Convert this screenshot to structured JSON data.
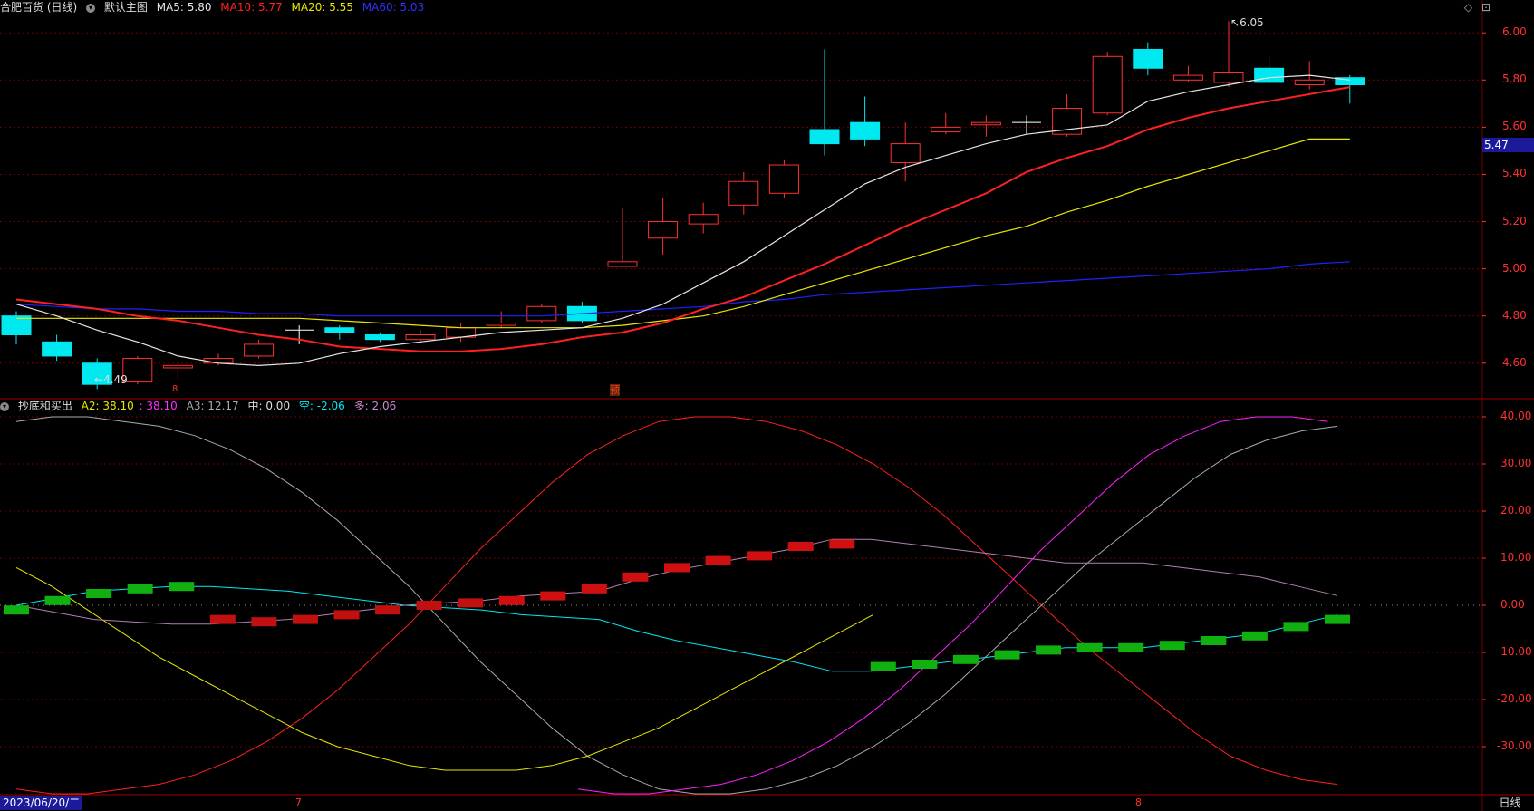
{
  "header": {
    "stock_title": "合肥百货 (日线)",
    "main_chart_label": "默认主图",
    "ma5_label": "MA5: 5.80",
    "ma10_label": "MA10: 5.77",
    "ma20_label": "MA20: 5.55",
    "ma60_label": "MA60: 5.03"
  },
  "indicator_header": {
    "name": "抄底和买出",
    "a2": "A2: 38.10",
    "a2b": ": 38.10",
    "a3": "A3: 12.17",
    "mid": "中: 0.00",
    "kong": "空: -2.06",
    "duo": "多: 2.06"
  },
  "colors": {
    "up": "#ff3030",
    "down": "#00e8f0",
    "ma5": "#e6e6e6",
    "ma10": "#ff2020",
    "ma20": "#e8e800",
    "ma60": "#2020ff",
    "grid": "#700000",
    "axis_text": "#ff3030"
  },
  "price_axis": {
    "ticks": [
      "6.00",
      "5.80",
      "5.60",
      "5.40",
      "5.20",
      "5.00",
      "4.80",
      "4.60"
    ],
    "current": "5.47"
  },
  "indicator_axis": {
    "ticks": [
      "40.00",
      "30.00",
      "20.00",
      "10.00",
      "0.00",
      "-10.00",
      "-20.00",
      "-30.00"
    ]
  },
  "annotations": {
    "high": "6.05",
    "low": "4.49",
    "marker_red": "8",
    "marker_yu": "预"
  },
  "bottom_axis": {
    "date": "2023/06/20/二",
    "month7": "7",
    "month8": "8",
    "period": "日线"
  },
  "top_icons": {
    "diamond": "◇",
    "window": "⊡"
  },
  "chart_data": {
    "type": "candlestick",
    "price_ylim": [
      4.48,
      6.07
    ],
    "candles": [
      {
        "o": 4.8,
        "c": 4.72,
        "h": 4.82,
        "l": 4.68
      },
      {
        "o": 4.69,
        "c": 4.63,
        "h": 4.72,
        "l": 4.61
      },
      {
        "o": 4.6,
        "c": 4.51,
        "h": 4.62,
        "l": 4.49
      },
      {
        "o": 4.52,
        "c": 4.62,
        "h": 4.63,
        "l": 4.51
      },
      {
        "o": 4.58,
        "c": 4.59,
        "h": 4.61,
        "l": 4.52
      },
      {
        "o": 4.6,
        "c": 4.62,
        "h": 4.64,
        "l": 4.59
      },
      {
        "o": 4.63,
        "c": 4.68,
        "h": 4.7,
        "l": 4.62
      },
      {
        "o": 4.74,
        "c": 4.74,
        "h": 4.76,
        "l": 4.68
      },
      {
        "o": 4.75,
        "c": 4.73,
        "h": 4.76,
        "l": 4.7
      },
      {
        "o": 4.72,
        "c": 4.7,
        "h": 4.73,
        "l": 4.69
      },
      {
        "o": 4.7,
        "c": 4.72,
        "h": 4.74,
        "l": 4.69
      },
      {
        "o": 4.71,
        "c": 4.75,
        "h": 4.77,
        "l": 4.69
      },
      {
        "o": 4.76,
        "c": 4.77,
        "h": 4.82,
        "l": 4.75
      },
      {
        "o": 4.78,
        "c": 4.84,
        "h": 4.85,
        "l": 4.77
      },
      {
        "o": 4.84,
        "c": 4.78,
        "h": 4.86,
        "l": 4.77
      },
      {
        "o": 5.01,
        "c": 5.03,
        "h": 5.26,
        "l": 5.01
      },
      {
        "o": 5.13,
        "c": 5.2,
        "h": 5.3,
        "l": 5.06
      },
      {
        "o": 5.19,
        "c": 5.23,
        "h": 5.28,
        "l": 5.15
      },
      {
        "o": 5.27,
        "c": 5.37,
        "h": 5.41,
        "l": 5.23
      },
      {
        "o": 5.32,
        "c": 5.44,
        "h": 5.46,
        "l": 5.3
      },
      {
        "o": 5.59,
        "c": 5.53,
        "h": 5.93,
        "l": 5.48
      },
      {
        "o": 5.62,
        "c": 5.55,
        "h": 5.73,
        "l": 5.52
      },
      {
        "o": 5.45,
        "c": 5.53,
        "h": 5.62,
        "l": 5.37
      },
      {
        "o": 5.58,
        "c": 5.6,
        "h": 5.66,
        "l": 5.57
      },
      {
        "o": 5.61,
        "c": 5.62,
        "h": 5.65,
        "l": 5.56
      },
      {
        "o": 5.62,
        "c": 5.62,
        "h": 5.65,
        "l": 5.57
      },
      {
        "o": 5.57,
        "c": 5.68,
        "h": 5.74,
        "l": 5.56
      },
      {
        "o": 5.66,
        "c": 5.9,
        "h": 5.92,
        "l": 5.65
      },
      {
        "o": 5.93,
        "c": 5.85,
        "h": 5.96,
        "l": 5.82
      },
      {
        "o": 5.8,
        "c": 5.82,
        "h": 5.86,
        "l": 5.79
      },
      {
        "o": 5.79,
        "c": 5.83,
        "h": 6.05,
        "l": 5.77
      },
      {
        "o": 5.85,
        "c": 5.79,
        "h": 5.9,
        "l": 5.78
      },
      {
        "o": 5.78,
        "c": 5.8,
        "h": 5.88,
        "l": 5.76
      },
      {
        "o": 5.81,
        "c": 5.78,
        "h": 5.82,
        "l": 5.7
      }
    ],
    "ma5": [
      4.85,
      4.8,
      4.74,
      4.69,
      4.63,
      4.6,
      4.59,
      4.6,
      4.64,
      4.67,
      4.69,
      4.71,
      4.73,
      4.74,
      4.75,
      4.79,
      4.85,
      4.94,
      5.03,
      5.14,
      5.25,
      5.36,
      5.43,
      5.48,
      5.53,
      5.57,
      5.59,
      5.61,
      5.71,
      5.75,
      5.78,
      5.81,
      5.82,
      5.8
    ],
    "ma10": [
      4.87,
      4.85,
      4.83,
      4.8,
      4.78,
      4.75,
      4.72,
      4.7,
      4.67,
      4.66,
      4.65,
      4.65,
      4.66,
      4.68,
      4.71,
      4.73,
      4.77,
      4.83,
      4.88,
      4.95,
      5.02,
      5.1,
      5.18,
      5.25,
      5.32,
      5.41,
      5.47,
      5.52,
      5.59,
      5.64,
      5.68,
      5.71,
      5.74,
      5.77
    ],
    "ma20": [
      4.79,
      4.79,
      4.79,
      4.79,
      4.79,
      4.79,
      4.79,
      4.79,
      4.78,
      4.77,
      4.76,
      4.75,
      4.75,
      4.75,
      4.75,
      4.76,
      4.78,
      4.8,
      4.84,
      4.89,
      4.94,
      4.99,
      5.04,
      5.09,
      5.14,
      5.18,
      5.24,
      5.29,
      5.35,
      5.4,
      5.45,
      5.5,
      5.55,
      5.55
    ],
    "ma60": [
      4.85,
      4.84,
      4.83,
      4.83,
      4.82,
      4.82,
      4.81,
      4.81,
      4.8,
      4.8,
      4.8,
      4.8,
      4.8,
      4.8,
      4.81,
      4.82,
      4.83,
      4.84,
      4.86,
      4.87,
      4.89,
      4.9,
      4.91,
      4.92,
      4.93,
      4.94,
      4.95,
      4.96,
      4.97,
      4.98,
      4.99,
      5.0,
      5.02,
      5.03
    ],
    "indicator_ylim": [
      -40,
      40
    ],
    "a2": [
      -39,
      -40,
      -40,
      -39,
      -38,
      -36,
      -33,
      -29,
      -24,
      -18,
      -11,
      -4,
      4,
      12,
      19,
      26,
      32,
      36,
      39,
      40,
      40,
      39,
      37,
      34,
      30,
      25,
      19,
      12,
      5,
      -2,
      -9,
      -15,
      -21,
      -27,
      -32,
      -35,
      -37,
      -38
    ],
    "a2b": [
      -39,
      -40,
      -40,
      -39,
      -38,
      -36,
      -33,
      -29,
      -24,
      -18,
      -11,
      -4,
      4,
      12,
      19,
      26,
      32,
      36,
      38
    ],
    "a3": [
      8,
      4,
      -1,
      -6,
      -11,
      -15,
      -19,
      -23,
      -27,
      -30,
      -32,
      -34,
      -35,
      -35,
      -35,
      -34,
      -32,
      -29,
      -26,
      -22,
      -18,
      -14,
      -10,
      -6,
      -2
    ],
    "kong": [
      0,
      1.5,
      3,
      3.5,
      4,
      4,
      3.5,
      3,
      2,
      1,
      0,
      -0.5,
      -1,
      -2,
      -2.5,
      -3,
      -5.5,
      -7.5,
      -9,
      -10.5,
      -12,
      -14,
      -14,
      -13,
      -12,
      -11,
      -10,
      -9,
      -9,
      -9,
      -8,
      -7,
      -6,
      -4,
      -2.06
    ],
    "duo": [
      0,
      -1.5,
      -3,
      -3.5,
      -4,
      -4,
      -3.5,
      -3,
      -2,
      -1,
      0,
      0.5,
      1,
      2,
      2.5,
      3,
      5.5,
      7.5,
      9,
      10.5,
      12,
      14,
      14,
      13,
      12,
      11,
      10,
      9,
      9,
      9,
      8,
      7,
      6,
      4,
      2.06
    ],
    "bars": [
      -1,
      1,
      2.5,
      3.5,
      4,
      -3,
      -3.5,
      -3,
      -2,
      -1,
      0,
      0.5,
      1,
      2,
      3.5,
      6,
      8,
      9.5,
      10.5,
      12.5,
      13,
      -13,
      -12.5,
      -11.5,
      -10.5,
      -9.5,
      -9,
      -9,
      -8.5,
      -7.5,
      -6.5,
      -4.5,
      -3
    ]
  }
}
